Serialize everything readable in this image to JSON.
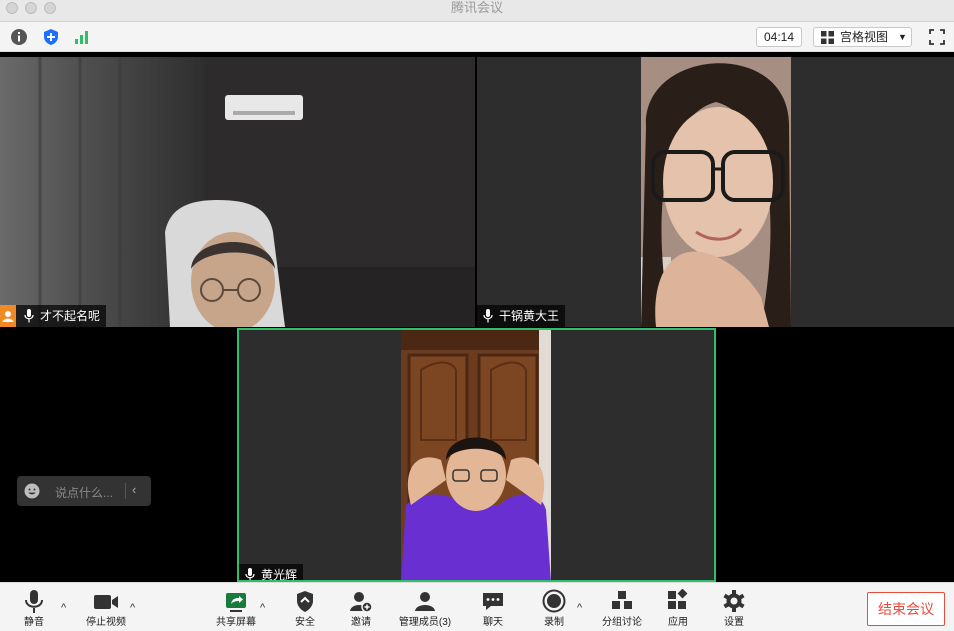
{
  "window": {
    "title": "腾讯会议"
  },
  "infobar": {
    "info_icon": "info-icon",
    "shield_icon": "shield-icon",
    "signal_icon": "signal-icon",
    "timer": "04:14",
    "view_label": "宫格视图",
    "fullscreen_icon": "fullscreen-icon"
  },
  "participants": [
    {
      "name": "才不起名呢"
    },
    {
      "name": "干锅黄大王"
    },
    {
      "name": "黄光辉"
    }
  ],
  "chat": {
    "placeholder": "说点什么..."
  },
  "toolbar": {
    "mute": "静音",
    "stop_video": "停止视频",
    "share_screen": "共享屏幕",
    "security": "安全",
    "invite": "邀请",
    "manage_members": "管理成员(3)",
    "chat": "聊天",
    "record": "录制",
    "breakout": "分组讨论",
    "apps": "应用",
    "settings": "设置",
    "end_meeting": "结束会议"
  },
  "colors": {
    "active_speaker_border": "#2fbf6a",
    "end_button": "#e84c3d",
    "shield": "#1e6fff",
    "signal": "#2fbf6a",
    "share": "#1a7a3d"
  }
}
